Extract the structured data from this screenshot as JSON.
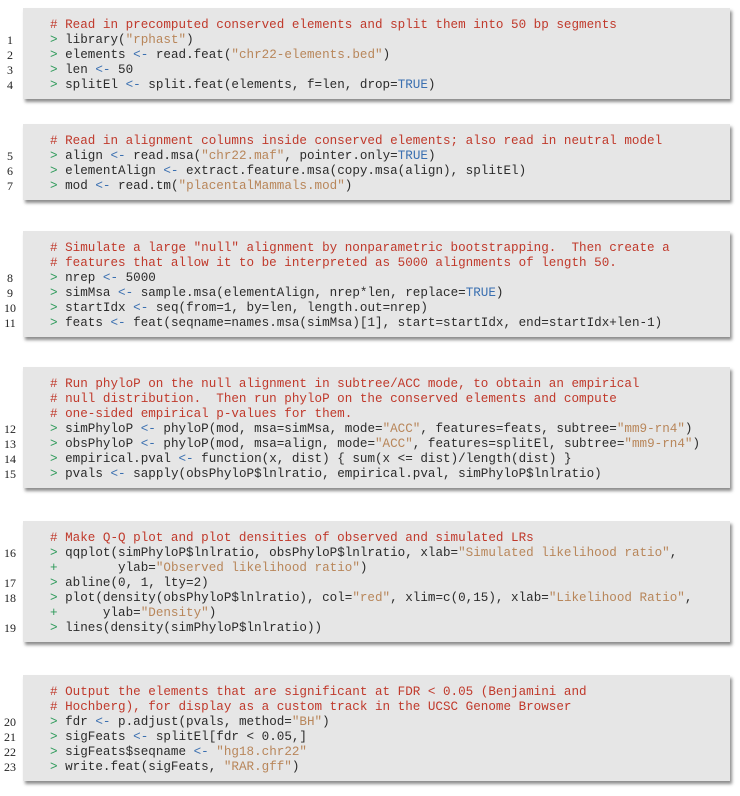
{
  "blocks": [
    {
      "lines": [
        {
          "num": "",
          "tokens": [
            {
              "t": "cmt",
              "v": "# Read in precomputed conserved elements and split them into 50 bp segments"
            }
          ]
        },
        {
          "num": "1",
          "tokens": [
            {
              "t": "prompt",
              "v": "> "
            },
            {
              "t": "plain",
              "v": "library("
            },
            {
              "t": "str",
              "v": "\"rphast\""
            },
            {
              "t": "plain",
              "v": ")"
            }
          ]
        },
        {
          "num": "2",
          "tokens": [
            {
              "t": "prompt",
              "v": "> "
            },
            {
              "t": "plain",
              "v": "elements "
            },
            {
              "t": "op",
              "v": "<-"
            },
            {
              "t": "plain",
              "v": " read.feat("
            },
            {
              "t": "str",
              "v": "\"chr22-elements.bed\""
            },
            {
              "t": "plain",
              "v": ")"
            }
          ]
        },
        {
          "num": "3",
          "tokens": [
            {
              "t": "prompt",
              "v": "> "
            },
            {
              "t": "plain",
              "v": "len "
            },
            {
              "t": "op",
              "v": "<-"
            },
            {
              "t": "plain",
              "v": " 50"
            }
          ]
        },
        {
          "num": "4",
          "tokens": [
            {
              "t": "prompt",
              "v": "> "
            },
            {
              "t": "plain",
              "v": "splitEl "
            },
            {
              "t": "op",
              "v": "<-"
            },
            {
              "t": "plain",
              "v": " split.feat(elements, f=len, drop="
            },
            {
              "t": "kw",
              "v": "TRUE"
            },
            {
              "t": "plain",
              "v": ")"
            }
          ]
        }
      ]
    },
    {
      "lines": [
        {
          "num": "",
          "tokens": [
            {
              "t": "cmt",
              "v": "# Read in alignment columns inside conserved elements; also read in neutral model"
            }
          ]
        },
        {
          "num": "5",
          "tokens": [
            {
              "t": "prompt",
              "v": "> "
            },
            {
              "t": "plain",
              "v": "align "
            },
            {
              "t": "op",
              "v": "<-"
            },
            {
              "t": "plain",
              "v": " read.msa("
            },
            {
              "t": "str",
              "v": "\"chr22.maf\""
            },
            {
              "t": "plain",
              "v": ", pointer.only="
            },
            {
              "t": "kw",
              "v": "TRUE"
            },
            {
              "t": "plain",
              "v": ")"
            }
          ]
        },
        {
          "num": "6",
          "tokens": [
            {
              "t": "prompt",
              "v": "> "
            },
            {
              "t": "plain",
              "v": "elementAlign "
            },
            {
              "t": "op",
              "v": "<-"
            },
            {
              "t": "plain",
              "v": " extract.feature.msa(copy.msa(align), splitEl)"
            }
          ]
        },
        {
          "num": "7",
          "tokens": [
            {
              "t": "prompt",
              "v": "> "
            },
            {
              "t": "plain",
              "v": "mod "
            },
            {
              "t": "op",
              "v": "<-"
            },
            {
              "t": "plain",
              "v": " read.tm("
            },
            {
              "t": "str",
              "v": "\"placentalMammals.mod\""
            },
            {
              "t": "plain",
              "v": ")"
            }
          ]
        }
      ]
    },
    {
      "lines": [
        {
          "num": "",
          "tokens": [
            {
              "t": "cmt",
              "v": "# Simulate a large \"null\" alignment by nonparametric bootstrapping.  Then create a"
            }
          ]
        },
        {
          "num": "",
          "tokens": [
            {
              "t": "cmt",
              "v": "# features that allow it to be interpreted as 5000 alignments of length 50."
            }
          ]
        },
        {
          "num": "8",
          "tokens": [
            {
              "t": "prompt",
              "v": "> "
            },
            {
              "t": "plain",
              "v": "nrep "
            },
            {
              "t": "op",
              "v": "<-"
            },
            {
              "t": "plain",
              "v": " 5000"
            }
          ]
        },
        {
          "num": "9",
          "tokens": [
            {
              "t": "prompt",
              "v": "> "
            },
            {
              "t": "plain",
              "v": "simMsa "
            },
            {
              "t": "op",
              "v": "<-"
            },
            {
              "t": "plain",
              "v": " sample.msa(elementAlign, nrep*len, replace="
            },
            {
              "t": "kw",
              "v": "TRUE"
            },
            {
              "t": "plain",
              "v": ")"
            }
          ]
        },
        {
          "num": "10",
          "tokens": [
            {
              "t": "prompt",
              "v": "> "
            },
            {
              "t": "plain",
              "v": "startIdx "
            },
            {
              "t": "op",
              "v": "<-"
            },
            {
              "t": "plain",
              "v": " seq(from=1, by=len, length.out=nrep)"
            }
          ]
        },
        {
          "num": "11",
          "tokens": [
            {
              "t": "prompt",
              "v": "> "
            },
            {
              "t": "plain",
              "v": "feats "
            },
            {
              "t": "op",
              "v": "<-"
            },
            {
              "t": "plain",
              "v": " feat(seqname=names.msa(simMsa)[1], start=startIdx, end=startIdx+len-1)"
            }
          ]
        }
      ]
    },
    {
      "lines": [
        {
          "num": "",
          "tokens": [
            {
              "t": "cmt",
              "v": "# Run phyloP on the null alignment in subtree/ACC mode, to obtain an empirical"
            }
          ]
        },
        {
          "num": "",
          "tokens": [
            {
              "t": "cmt",
              "v": "# null distribution.  Then run phyloP on the conserved elements and compute"
            }
          ]
        },
        {
          "num": "",
          "tokens": [
            {
              "t": "cmt",
              "v": "# one-sided empirical p-values for them."
            }
          ]
        },
        {
          "num": "12",
          "tokens": [
            {
              "t": "prompt",
              "v": "> "
            },
            {
              "t": "plain",
              "v": "simPhyloP "
            },
            {
              "t": "op",
              "v": "<-"
            },
            {
              "t": "plain",
              "v": " phyloP(mod, msa=simMsa, mode="
            },
            {
              "t": "str",
              "v": "\"ACC\""
            },
            {
              "t": "plain",
              "v": ", features=feats, subtree="
            },
            {
              "t": "str",
              "v": "\"mm9-rn4\""
            },
            {
              "t": "plain",
              "v": ")"
            }
          ]
        },
        {
          "num": "13",
          "tokens": [
            {
              "t": "prompt",
              "v": "> "
            },
            {
              "t": "plain",
              "v": "obsPhyloP "
            },
            {
              "t": "op",
              "v": "<-"
            },
            {
              "t": "plain",
              "v": " phyloP(mod, msa=align, mode="
            },
            {
              "t": "str",
              "v": "\"ACC\""
            },
            {
              "t": "plain",
              "v": ", features=splitEl, subtree="
            },
            {
              "t": "str",
              "v": "\"mm9-rn4\""
            },
            {
              "t": "plain",
              "v": ")"
            }
          ]
        },
        {
          "num": "14",
          "tokens": [
            {
              "t": "prompt",
              "v": "> "
            },
            {
              "t": "plain",
              "v": "empirical.pval "
            },
            {
              "t": "op",
              "v": "<-"
            },
            {
              "t": "plain",
              "v": " function(x, dist) { sum(x <= dist)/length(dist) }"
            }
          ]
        },
        {
          "num": "15",
          "tokens": [
            {
              "t": "prompt",
              "v": "> "
            },
            {
              "t": "plain",
              "v": "pvals "
            },
            {
              "t": "op",
              "v": "<-"
            },
            {
              "t": "plain",
              "v": " sapply(obsPhyloP$lnlratio, empirical.pval, simPhyloP$lnlratio)"
            }
          ]
        }
      ]
    },
    {
      "lines": [
        {
          "num": "",
          "tokens": [
            {
              "t": "cmt",
              "v": "# Make Q-Q plot and plot densities of observed and simulated LRs"
            }
          ]
        },
        {
          "num": "16",
          "tokens": [
            {
              "t": "prompt",
              "v": "> "
            },
            {
              "t": "plain",
              "v": "qqplot(simPhyloP$lnlratio, obsPhyloP$lnlratio, xlab="
            },
            {
              "t": "str",
              "v": "\"Simulated likelihood ratio\""
            },
            {
              "t": "plain",
              "v": ","
            }
          ]
        },
        {
          "num": "",
          "tokens": [
            {
              "t": "prompt",
              "v": "+ "
            },
            {
              "t": "plain",
              "v": "       ylab="
            },
            {
              "t": "str",
              "v": "\"Observed likelihood ratio\""
            },
            {
              "t": "plain",
              "v": ")"
            }
          ]
        },
        {
          "num": "17",
          "tokens": [
            {
              "t": "prompt",
              "v": "> "
            },
            {
              "t": "plain",
              "v": "abline(0, 1, lty=2)"
            }
          ]
        },
        {
          "num": "18",
          "tokens": [
            {
              "t": "prompt",
              "v": "> "
            },
            {
              "t": "plain",
              "v": "plot(density(obsPhyloP$lnlratio), col="
            },
            {
              "t": "str",
              "v": "\"red\""
            },
            {
              "t": "plain",
              "v": ", xlim=c(0,15), xlab="
            },
            {
              "t": "str",
              "v": "\"Likelihood Ratio\""
            },
            {
              "t": "plain",
              "v": ","
            }
          ]
        },
        {
          "num": "",
          "tokens": [
            {
              "t": "prompt",
              "v": "+ "
            },
            {
              "t": "plain",
              "v": "     ylab="
            },
            {
              "t": "str",
              "v": "\"Density\""
            },
            {
              "t": "plain",
              "v": ")"
            }
          ]
        },
        {
          "num": "19",
          "tokens": [
            {
              "t": "prompt",
              "v": "> "
            },
            {
              "t": "plain",
              "v": "lines(density(simPhyloP$lnlratio))"
            }
          ]
        }
      ]
    },
    {
      "lines": [
        {
          "num": "",
          "tokens": [
            {
              "t": "cmt",
              "v": "# Output the elements that are significant at FDR < 0.05 (Benjamini and"
            }
          ]
        },
        {
          "num": "",
          "tokens": [
            {
              "t": "cmt",
              "v": "# Hochberg), for display as a custom track in the UCSC Genome Browser"
            }
          ]
        },
        {
          "num": "20",
          "tokens": [
            {
              "t": "prompt",
              "v": "> "
            },
            {
              "t": "plain",
              "v": "fdr "
            },
            {
              "t": "op",
              "v": "<-"
            },
            {
              "t": "plain",
              "v": " p.adjust(pvals, method="
            },
            {
              "t": "str",
              "v": "\"BH\""
            },
            {
              "t": "plain",
              "v": ")"
            }
          ]
        },
        {
          "num": "21",
          "tokens": [
            {
              "t": "prompt",
              "v": "> "
            },
            {
              "t": "plain",
              "v": "sigFeats "
            },
            {
              "t": "op",
              "v": "<-"
            },
            {
              "t": "plain",
              "v": " splitEl[fdr < 0.05,]"
            }
          ]
        },
        {
          "num": "22",
          "tokens": [
            {
              "t": "prompt",
              "v": "> "
            },
            {
              "t": "plain",
              "v": "sigFeats$seqname "
            },
            {
              "t": "op",
              "v": "<-"
            },
            {
              "t": "plain",
              "v": " "
            },
            {
              "t": "str",
              "v": "\"hg18.chr22\""
            }
          ]
        },
        {
          "num": "23",
          "tokens": [
            {
              "t": "prompt",
              "v": "> "
            },
            {
              "t": "plain",
              "v": "write.feat(sigFeats, "
            },
            {
              "t": "str",
              "v": "\"RAR.gff\""
            },
            {
              "t": "plain",
              "v": ")"
            }
          ]
        }
      ]
    }
  ]
}
